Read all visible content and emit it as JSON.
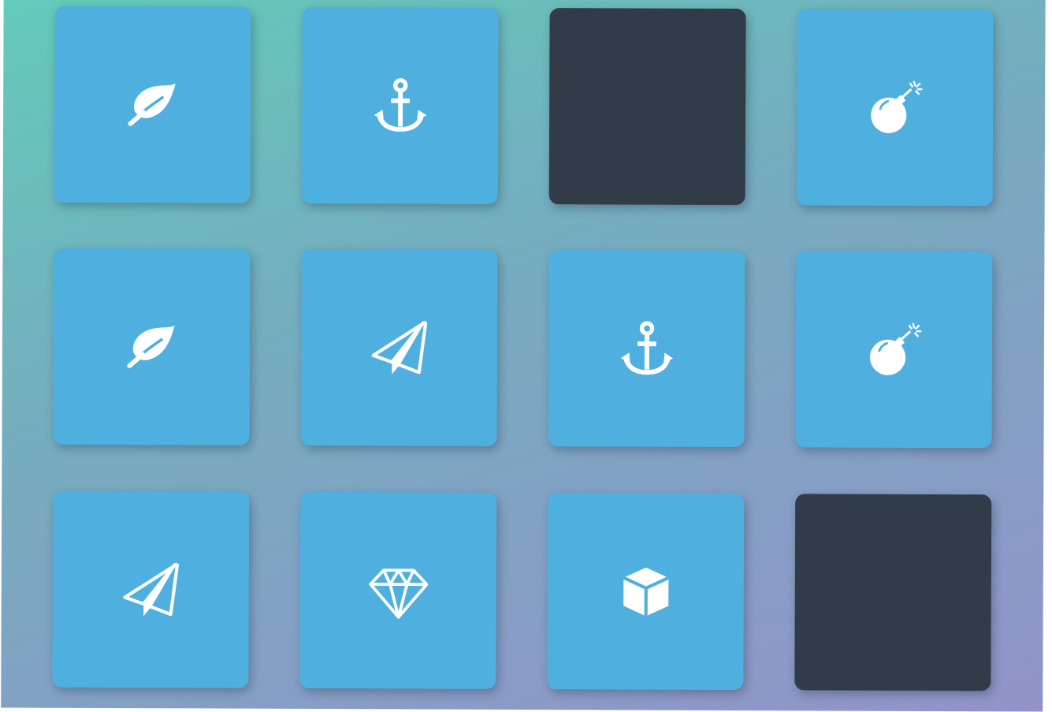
{
  "game": {
    "colors": {
      "card_open": "#4fb0e0",
      "card_closed": "#323c48",
      "icon": "#ffffff",
      "background_gradient": [
        "#62cdb9",
        "#9393c9"
      ]
    },
    "cards": [
      {
        "row": 1,
        "col": 1,
        "state": "open",
        "icon": "leaf-icon"
      },
      {
        "row": 1,
        "col": 2,
        "state": "open",
        "icon": "anchor-icon"
      },
      {
        "row": 1,
        "col": 3,
        "state": "closed",
        "icon": ""
      },
      {
        "row": 1,
        "col": 4,
        "state": "open",
        "icon": "bomb-icon"
      },
      {
        "row": 2,
        "col": 1,
        "state": "open",
        "icon": "leaf-icon"
      },
      {
        "row": 2,
        "col": 2,
        "state": "open",
        "icon": "paper-plane-icon"
      },
      {
        "row": 2,
        "col": 3,
        "state": "open",
        "icon": "anchor-icon"
      },
      {
        "row": 2,
        "col": 4,
        "state": "open",
        "icon": "bomb-icon"
      },
      {
        "row": 3,
        "col": 1,
        "state": "open",
        "icon": "paper-plane-icon"
      },
      {
        "row": 3,
        "col": 2,
        "state": "open",
        "icon": "diamond-icon"
      },
      {
        "row": 3,
        "col": 3,
        "state": "open",
        "icon": "cube-icon"
      },
      {
        "row": 3,
        "col": 4,
        "state": "closed",
        "icon": ""
      }
    ]
  }
}
